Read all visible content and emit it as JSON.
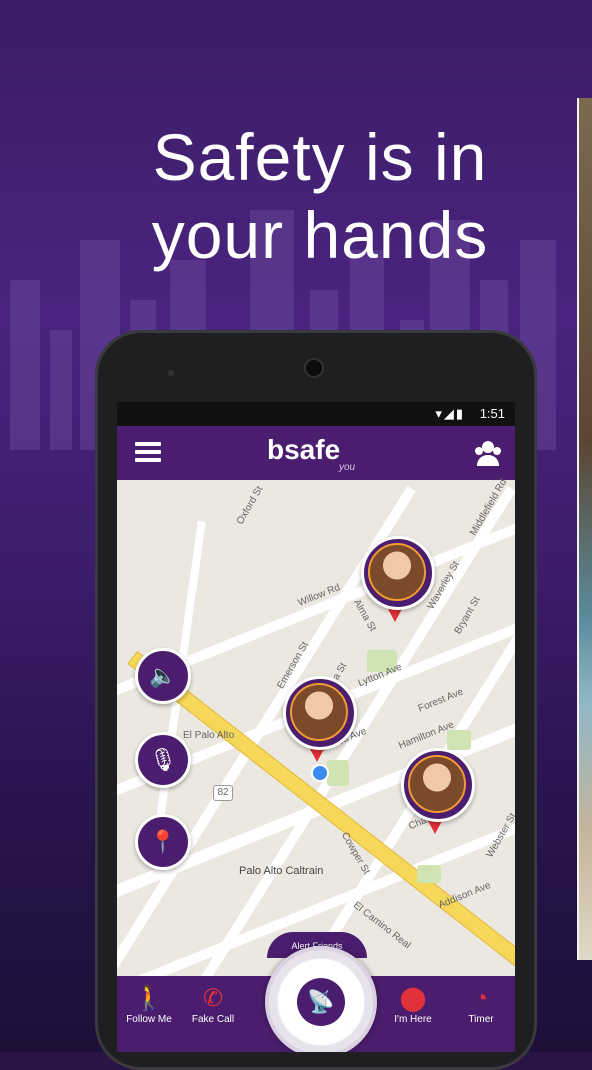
{
  "headline": {
    "line1": "Safety is in",
    "line2": "your hands"
  },
  "status_bar": {
    "time": "1:51",
    "icons": "▾◢▮"
  },
  "app_bar": {
    "logo": "bsafe",
    "logo_sub": "you"
  },
  "map": {
    "labels": [
      "Oxford St",
      "Willow Rd",
      "Alma St",
      "El Palo Alto",
      "Palo Alto Caltrain",
      "Middlefield Rd",
      "Lytton Ave",
      "Emerson St",
      "Ramona St",
      "Waverley St",
      "Bryant St",
      "Everett Ave",
      "Cowper St",
      "Hamilton Ave",
      "Forest Ave",
      "Channing Ave",
      "Webster St",
      "Addison Ave",
      "El Camino Real"
    ],
    "route_shield": "82"
  },
  "pins": [
    {
      "name": "friend-1"
    },
    {
      "name": "friend-2"
    },
    {
      "name": "friend-3"
    }
  ],
  "bottom_nav": {
    "center_label": "Alert Friends",
    "tabs": [
      {
        "label": "Follow Me",
        "icon": "walk-icon"
      },
      {
        "label": "Fake Call",
        "icon": "phone-icon"
      },
      {
        "label": "I'm Here",
        "icon": "location-pin-icon"
      },
      {
        "label": "Timer",
        "icon": "timer-icon"
      }
    ]
  },
  "colors": {
    "brand_purple": "#4b1d6e",
    "alert_red": "#e2313a",
    "highlight_orange": "#f29b32"
  }
}
